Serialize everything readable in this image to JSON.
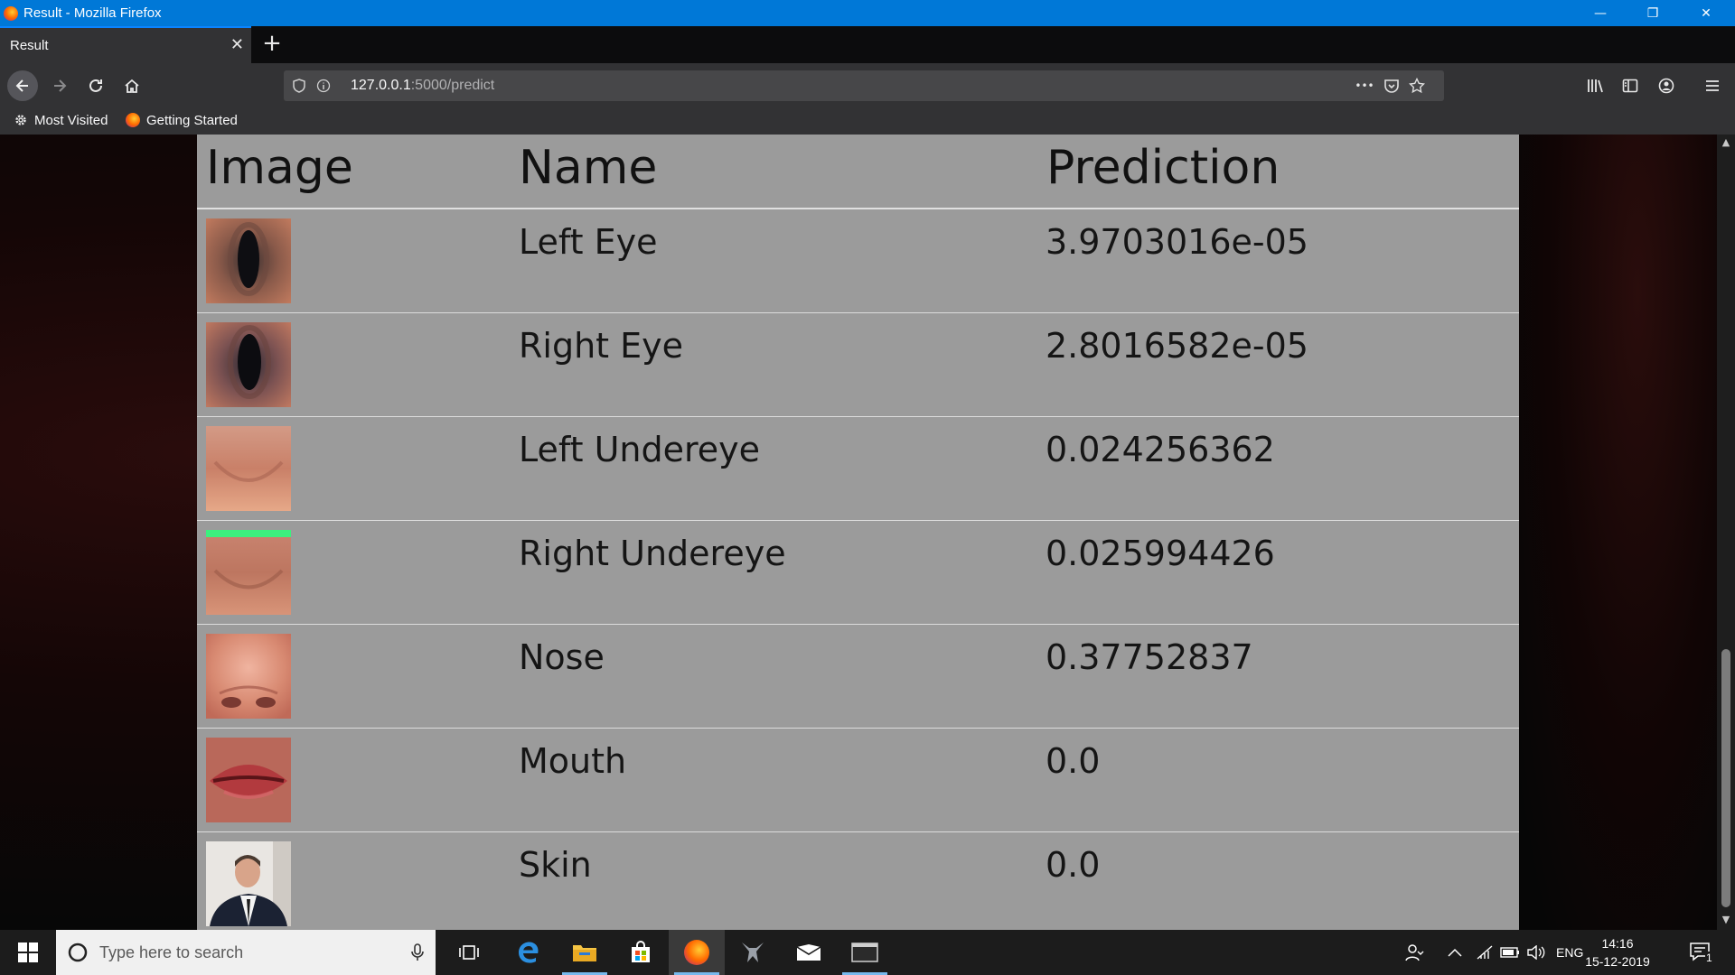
{
  "window": {
    "title": "Result - Mozilla Firefox",
    "minimize_glyph": "—",
    "restore_glyph": "❐",
    "close_glyph": "✕"
  },
  "tabs": [
    {
      "label": "Result",
      "active": true
    }
  ],
  "toolbar": {
    "new_tab_glyph": "+",
    "url_host": "127.0.0.1",
    "url_path": ":5000/predict",
    "more_glyph": "•••"
  },
  "bookmarks": [
    {
      "label": "Most Visited",
      "icon": "gear-icon"
    },
    {
      "label": "Getting Started",
      "icon": "firefox-icon"
    }
  ],
  "table": {
    "headers": [
      "Image",
      "Name",
      "Prediction"
    ],
    "rows": [
      {
        "name": "Left Eye",
        "prediction": "3.9703016e-05",
        "thumb": "eye"
      },
      {
        "name": "Right Eye",
        "prediction": "2.8016582e-05",
        "thumb": "eye"
      },
      {
        "name": "Left Undereye",
        "prediction": "0.024256362",
        "thumb": "skin"
      },
      {
        "name": "Right Undereye",
        "prediction": "0.025994426",
        "thumb": "skin-green"
      },
      {
        "name": "Nose",
        "prediction": "0.37752837",
        "thumb": "nose"
      },
      {
        "name": "Mouth",
        "prediction": "0.0",
        "thumb": "mouth"
      },
      {
        "name": "Skin",
        "prediction": "0.0",
        "thumb": "portrait"
      }
    ]
  },
  "taskbar": {
    "search_placeholder": "Type here to search",
    "language": "ENG",
    "time": "14:16",
    "date": "15-12-2019",
    "notifications_count": "1"
  },
  "colors": {
    "titlebar": "#0078d7",
    "panel": "#9b9b9b",
    "toolbar": "#323234",
    "taskbar": "#1c1c1c"
  }
}
